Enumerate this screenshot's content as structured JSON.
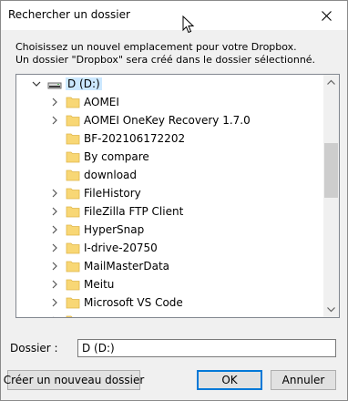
{
  "window": {
    "title": "Rechercher un dossier",
    "close_icon": "close-icon"
  },
  "instructions": {
    "line1": "Choisissez un nouvel emplacement pour votre Dropbox.",
    "line2": "Un dossier \"Dropbox\" sera créé dans le dossier sélectionné."
  },
  "tree": {
    "drive": {
      "label": "D (D:)",
      "icon": "drive-icon",
      "expanded": true,
      "selected": true
    },
    "folders": [
      {
        "label": "AOMEI",
        "expandable": true
      },
      {
        "label": "AOMEI OneKey Recovery 1.7.0",
        "expandable": true
      },
      {
        "label": "BF-202106172202",
        "expandable": false
      },
      {
        "label": "By compare",
        "expandable": false
      },
      {
        "label": "download",
        "expandable": false
      },
      {
        "label": "FileHistory",
        "expandable": true
      },
      {
        "label": "FileZilla FTP Client",
        "expandable": true
      },
      {
        "label": "HyperSnap",
        "expandable": true
      },
      {
        "label": "I-drive-20750",
        "expandable": true
      },
      {
        "label": "MailMasterData",
        "expandable": true
      },
      {
        "label": "Meitu",
        "expandable": true
      },
      {
        "label": "Microsoft VS Code",
        "expandable": true
      },
      {
        "label": "",
        "expandable": true
      }
    ],
    "folder_color": "#f8d775",
    "selection_color": "#cce8ff"
  },
  "dossier": {
    "label": "Dossier :",
    "value": "D (D:)"
  },
  "buttons": {
    "new_folder": "Créer un nouveau dossier",
    "ok": "OK",
    "cancel": "Annuler"
  },
  "colors": {
    "dialog_bg": "#f0f0f0",
    "accent": "#0078d7"
  }
}
